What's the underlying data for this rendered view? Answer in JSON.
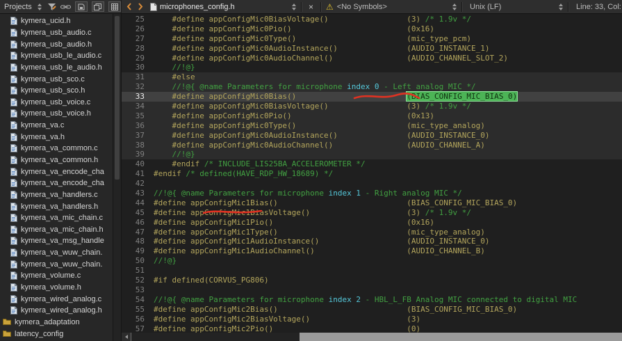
{
  "topbar": {
    "projects_label": "Projects",
    "tab": {
      "file_name": "microphones_config.h"
    },
    "symbols_label": "<No Symbols>",
    "encoding_label": "Unix (LF)",
    "caret_label": "Line: 33, Col:"
  },
  "icons": {
    "close": "×",
    "warning": "⚠"
  },
  "colors": {
    "background": "#1f1f1f",
    "code": "#b3a55c",
    "comment": "#42a142",
    "search_highlight": "#55c8da",
    "selection_bg": "#4cb456",
    "current_line_bg": "#414141",
    "inactive_band_bg": "#2c2c2c",
    "annotation_red": "#e03222",
    "warning_yellow": "#e3c22e",
    "chevron_orange": "#d98c3a"
  },
  "sidebar": {
    "items": [
      {
        "label": "kymera_ucid.h",
        "type": "file"
      },
      {
        "label": "kymera_usb_audio.c",
        "type": "file"
      },
      {
        "label": "kymera_usb_audio.h",
        "type": "file"
      },
      {
        "label": "kymera_usb_le_audio.c",
        "type": "file"
      },
      {
        "label": "kymera_usb_le_audio.h",
        "type": "file"
      },
      {
        "label": "kymera_usb_sco.c",
        "type": "file"
      },
      {
        "label": "kymera_usb_sco.h",
        "type": "file"
      },
      {
        "label": "kymera_usb_voice.c",
        "type": "file"
      },
      {
        "label": "kymera_usb_voice.h",
        "type": "file"
      },
      {
        "label": "kymera_va.c",
        "type": "file"
      },
      {
        "label": "kymera_va.h",
        "type": "file"
      },
      {
        "label": "kymera_va_common.c",
        "type": "file"
      },
      {
        "label": "kymera_va_common.h",
        "type": "file"
      },
      {
        "label": "kymera_va_encode_cha",
        "type": "file"
      },
      {
        "label": "kymera_va_encode_cha",
        "type": "file"
      },
      {
        "label": "kymera_va_handlers.c",
        "type": "file"
      },
      {
        "label": "kymera_va_handlers.h",
        "type": "file"
      },
      {
        "label": "kymera_va_mic_chain.c",
        "type": "file"
      },
      {
        "label": "kymera_va_mic_chain.h",
        "type": "file"
      },
      {
        "label": "kymera_va_msg_handle",
        "type": "file"
      },
      {
        "label": "kymera_va_wuw_chain.",
        "type": "file"
      },
      {
        "label": "kymera_va_wuw_chain.",
        "type": "file"
      },
      {
        "label": "kymera_volume.c",
        "type": "file"
      },
      {
        "label": "kymera_volume.h",
        "type": "file"
      },
      {
        "label": "kymera_wired_analog.c",
        "type": "file"
      },
      {
        "label": "kymera_wired_analog.h",
        "type": "file"
      },
      {
        "label": "kymera_adaptation",
        "type": "folder"
      },
      {
        "label": "latency_config",
        "type": "folder"
      }
    ]
  },
  "editor": {
    "band_start": 31,
    "band_end": 39,
    "current_line": 33,
    "lines": [
      {
        "n": 25,
        "segs": [
          [
            "c",
            "    #define appConfigMic0BiasVoltage()                 (3) "
          ],
          [
            "g",
            "/* 1.9v */"
          ]
        ]
      },
      {
        "n": 26,
        "segs": [
          [
            "c",
            "    #define appConfigMic0Pio()                         (0x16)"
          ]
        ]
      },
      {
        "n": 27,
        "segs": [
          [
            "c",
            "    #define appConfigMic0Type()                        (mic_type_pcm)"
          ]
        ]
      },
      {
        "n": 28,
        "segs": [
          [
            "c",
            "    #define appConfigMic0AudioInstance()               (AUDIO_INSTANCE_1)"
          ]
        ]
      },
      {
        "n": 29,
        "segs": [
          [
            "c",
            "    #define appConfigMic0AudioChannel()                (AUDIO_CHANNEL_SLOT_2)"
          ]
        ]
      },
      {
        "n": 30,
        "segs": [
          [
            "g",
            "    //!@}"
          ]
        ]
      },
      {
        "n": 31,
        "segs": [
          [
            "c",
            "    #else"
          ]
        ]
      },
      {
        "n": 32,
        "segs": [
          [
            "g",
            "    //!@{ @name Parameters for microphone "
          ],
          [
            "x",
            "index 0"
          ],
          [
            "g",
            " - Left analog MIC */"
          ]
        ]
      },
      {
        "n": 33,
        "segs": [
          [
            "c",
            "    #define appConfigMic0Bias()                        "
          ],
          [
            "k",
            ""
          ],
          [
            "s",
            "(BIAS_CONFIG_MIC_BIAS_0)"
          ]
        ]
      },
      {
        "n": 34,
        "segs": [
          [
            "c",
            "    #define appConfigMic0BiasVoltage()                 (3) "
          ],
          [
            "g",
            "/* 1.9v */"
          ]
        ]
      },
      {
        "n": 35,
        "segs": [
          [
            "c",
            "    #define appConfigMic0Pio()                         (0x13)"
          ]
        ]
      },
      {
        "n": 36,
        "segs": [
          [
            "c",
            "    #define appConfigMic0Type()                        (mic_type_analog)"
          ]
        ]
      },
      {
        "n": 37,
        "segs": [
          [
            "c",
            "    #define appConfigMic0AudioInstance()               (AUDIO_INSTANCE_0)"
          ]
        ]
      },
      {
        "n": 38,
        "segs": [
          [
            "c",
            "    #define appConfigMic0AudioChannel()                (AUDIO_CHANNEL_A)"
          ]
        ]
      },
      {
        "n": 39,
        "segs": [
          [
            "g",
            "    //!@}"
          ]
        ]
      },
      {
        "n": 40,
        "segs": [
          [
            "c",
            "    #endif "
          ],
          [
            "g",
            "/* INCLUDE_LIS25BA_ACCELEROMETER */"
          ]
        ]
      },
      {
        "n": 41,
        "segs": [
          [
            "c",
            "#endif "
          ],
          [
            "g",
            "/* defined(HAVE_RDP_HW_18689) */"
          ]
        ]
      },
      {
        "n": 42,
        "segs": []
      },
      {
        "n": 43,
        "segs": [
          [
            "g",
            "//!@{ @name Parameters for microphone "
          ],
          [
            "x",
            "index 1"
          ],
          [
            "g",
            " - Right analog MIC */"
          ]
        ]
      },
      {
        "n": 44,
        "segs": [
          [
            "c",
            "#define appConfigMic1Bias()                            (BIAS_CONFIG_MIC_BIAS_0)"
          ]
        ]
      },
      {
        "n": 45,
        "segs": [
          [
            "c",
            "#define appConfigMic1BiasVoltage()                     (3) "
          ],
          [
            "g",
            "/* 1.9v */"
          ]
        ]
      },
      {
        "n": 46,
        "segs": [
          [
            "c",
            "#define appConfigMic1Pio()                             (0x16)"
          ]
        ]
      },
      {
        "n": 47,
        "segs": [
          [
            "c",
            "#define appConfigMic1Type()                            (mic_type_analog)"
          ]
        ]
      },
      {
        "n": 48,
        "segs": [
          [
            "c",
            "#define appConfigMic1AudioInstance()                   (AUDIO_INSTANCE_0)"
          ]
        ]
      },
      {
        "n": 49,
        "segs": [
          [
            "c",
            "#define appConfigMic1AudioChannel()                    (AUDIO_CHANNEL_B)"
          ]
        ]
      },
      {
        "n": 50,
        "segs": [
          [
            "g",
            "//!@}"
          ]
        ]
      },
      {
        "n": 51,
        "segs": []
      },
      {
        "n": 52,
        "segs": [
          [
            "c",
            "#if defined(CORVUS_PG806)"
          ]
        ]
      },
      {
        "n": 53,
        "segs": []
      },
      {
        "n": 54,
        "segs": [
          [
            "g",
            "//!@{ @name Parameters for microphone "
          ],
          [
            "x",
            "index 2"
          ],
          [
            "g",
            " - HBL_L_FB Analog MIC connected to digital MIC"
          ]
        ]
      },
      {
        "n": 55,
        "segs": [
          [
            "c",
            "#define appConfigMic2Bias()                            (BIAS_CONFIG_MIC_BIAS_0)"
          ]
        ]
      },
      {
        "n": 56,
        "segs": [
          [
            "c",
            "#define appConfigMic2BiasVoltage()                     (3)"
          ]
        ]
      },
      {
        "n": 57,
        "segs": [
          [
            "c",
            "#define appConfigMic2Pio()                             (0)"
          ]
        ]
      }
    ]
  }
}
